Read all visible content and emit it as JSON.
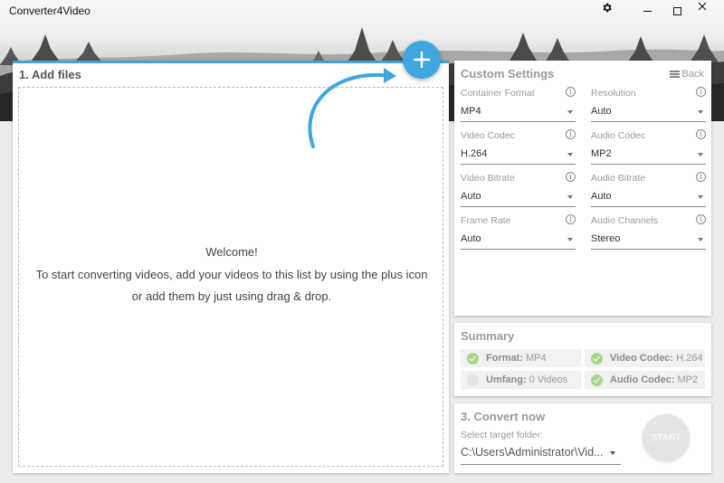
{
  "window": {
    "title": "Converter4Video",
    "controls": {
      "settings_icon": "gear-icon",
      "minimize_icon": "minimize-icon",
      "maximize_icon": "maximize-icon",
      "close_icon": "close-icon"
    }
  },
  "colors": {
    "accent": "#42a5d8",
    "plus_button": "#3fa6e0",
    "check_on": "#a9d68c",
    "start_disabled": "#e4e4e4"
  },
  "add_files": {
    "title": "1. Add files",
    "add_icon": "plus-icon",
    "welcome": {
      "line1": "Welcome!",
      "line2": "To start converting videos, add your videos to this list by using the plus icon",
      "line3": "or add them by just using drag & drop."
    }
  },
  "custom_settings": {
    "title": "Custom Settings",
    "back_label": "Back",
    "back_icon": "menu-icon",
    "fields": [
      {
        "label": "Container Format",
        "value": "MP4"
      },
      {
        "label": "Resolution",
        "value": "Auto"
      },
      {
        "label": "Video Codec",
        "value": "H.264"
      },
      {
        "label": "Audio Codec",
        "value": "MP2"
      },
      {
        "label": "Video Bitrate",
        "value": "Auto"
      },
      {
        "label": "Audio Bitrate",
        "value": "Auto"
      },
      {
        "label": "Frame Rate",
        "value": "Auto"
      },
      {
        "label": "Audio Channels",
        "value": "Stereo"
      }
    ]
  },
  "summary": {
    "title": "Summary",
    "items": [
      {
        "key": "Format:",
        "value": "MP4",
        "checked": true
      },
      {
        "key": "Video Codec:",
        "value": "H.264",
        "checked": true
      },
      {
        "key": "Umfang:",
        "value": "0 Videos",
        "checked": false
      },
      {
        "key": "Audio Codec:",
        "value": "MP2",
        "checked": true
      }
    ]
  },
  "convert": {
    "title": "3. Convert now",
    "target_label": "Select target folder:",
    "target_value": "C:\\Users\\Administrator\\Vid...",
    "start_label": "START"
  }
}
